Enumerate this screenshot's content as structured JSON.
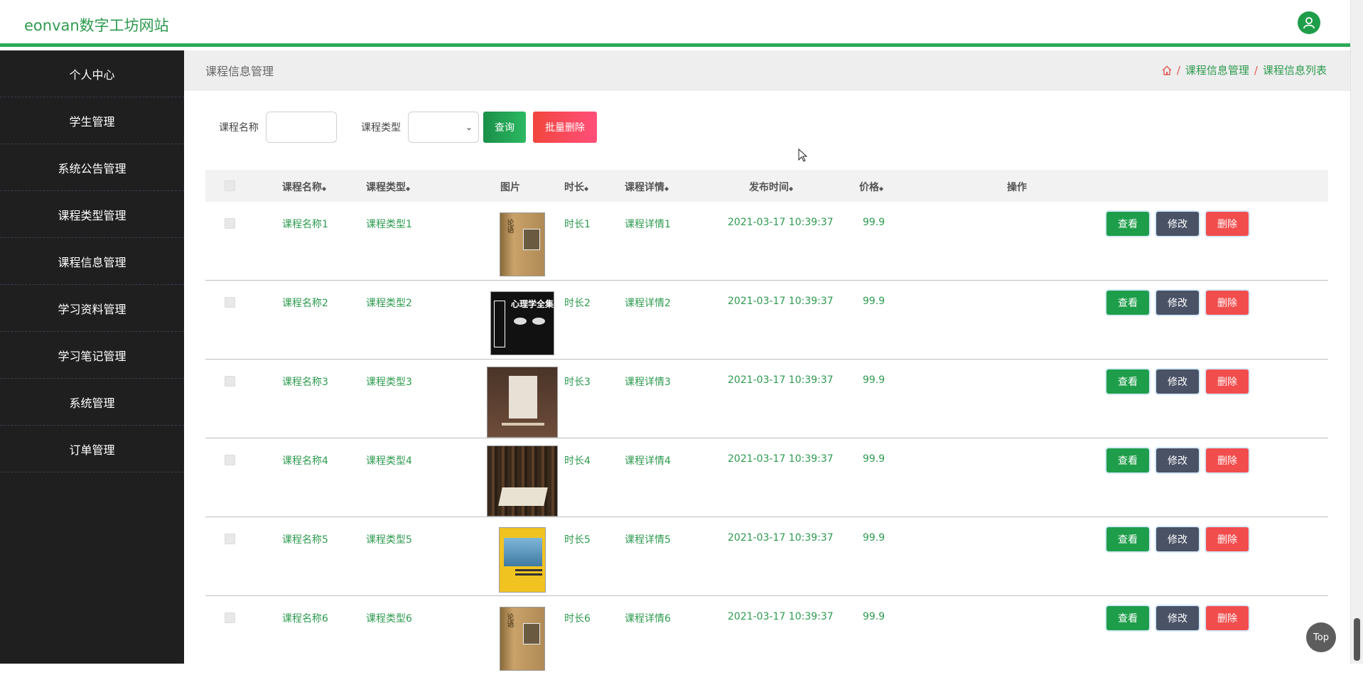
{
  "header": {
    "brand": "eonvan数字工坊网站",
    "avatar_icon": "user-icon"
  },
  "sidebar": {
    "items": [
      {
        "label": "个人中心"
      },
      {
        "label": "学生管理"
      },
      {
        "label": "系统公告管理"
      },
      {
        "label": "课程类型管理"
      },
      {
        "label": "课程信息管理"
      },
      {
        "label": "学习资料管理"
      },
      {
        "label": "学习笔记管理"
      },
      {
        "label": "系统管理"
      },
      {
        "label": "订单管理"
      }
    ]
  },
  "crumb": {
    "title": "课程信息管理",
    "home_icon": "home-icon",
    "sep": "/",
    "path": [
      "课程信息管理",
      "课程信息列表"
    ]
  },
  "filters": {
    "name_label": "课程名称",
    "name_value": "",
    "type_label": "课程类型",
    "type_value": "",
    "query_label": "查询",
    "batch_delete_label": "批量删除"
  },
  "table": {
    "headers": {
      "name": "课程名称",
      "type": "课程类型",
      "image": "图片",
      "duration": "时长",
      "detail": "课程详情",
      "time": "发布时间",
      "price": "价格",
      "ops": "操作"
    },
    "sort_icon": "◆",
    "rows": [
      {
        "name": "课程名称1",
        "type": "课程类型1",
        "duration": "时长1",
        "detail": "课程详情1",
        "time": "2021-03-17 10:39:37",
        "price": "99.9",
        "cover": "论语"
      },
      {
        "name": "课程名称2",
        "type": "课程类型2",
        "duration": "时长2",
        "detail": "课程详情2",
        "time": "2021-03-17 10:39:37",
        "price": "99.9",
        "cover": "心理学全集"
      },
      {
        "name": "课程名称3",
        "type": "课程类型3",
        "duration": "时长3",
        "detail": "课程详情3",
        "time": "2021-03-17 10:39:37",
        "price": "99.9",
        "cover": ""
      },
      {
        "name": "课程名称4",
        "type": "课程类型4",
        "duration": "时长4",
        "detail": "课程详情4",
        "time": "2021-03-17 10:39:37",
        "price": "99.9",
        "cover": ""
      },
      {
        "name": "课程名称5",
        "type": "课程类型5",
        "duration": "时长5",
        "detail": "课程详情5",
        "time": "2021-03-17 10:39:37",
        "price": "99.9",
        "cover": ""
      },
      {
        "name": "课程名称6",
        "type": "课程类型6",
        "duration": "时长6",
        "detail": "课程详情6",
        "time": "2021-03-17 10:39:37",
        "price": "99.9",
        "cover": "论语"
      }
    ],
    "actions": {
      "view": "查看",
      "edit": "修改",
      "delete": "删除"
    }
  },
  "totop": "Top",
  "colors": {
    "accent": "#2d9a4f",
    "view": "#1e9e4a",
    "edit": "#4a5266",
    "delete": "#f24d4d",
    "sidebar": "#1f1f1f"
  }
}
